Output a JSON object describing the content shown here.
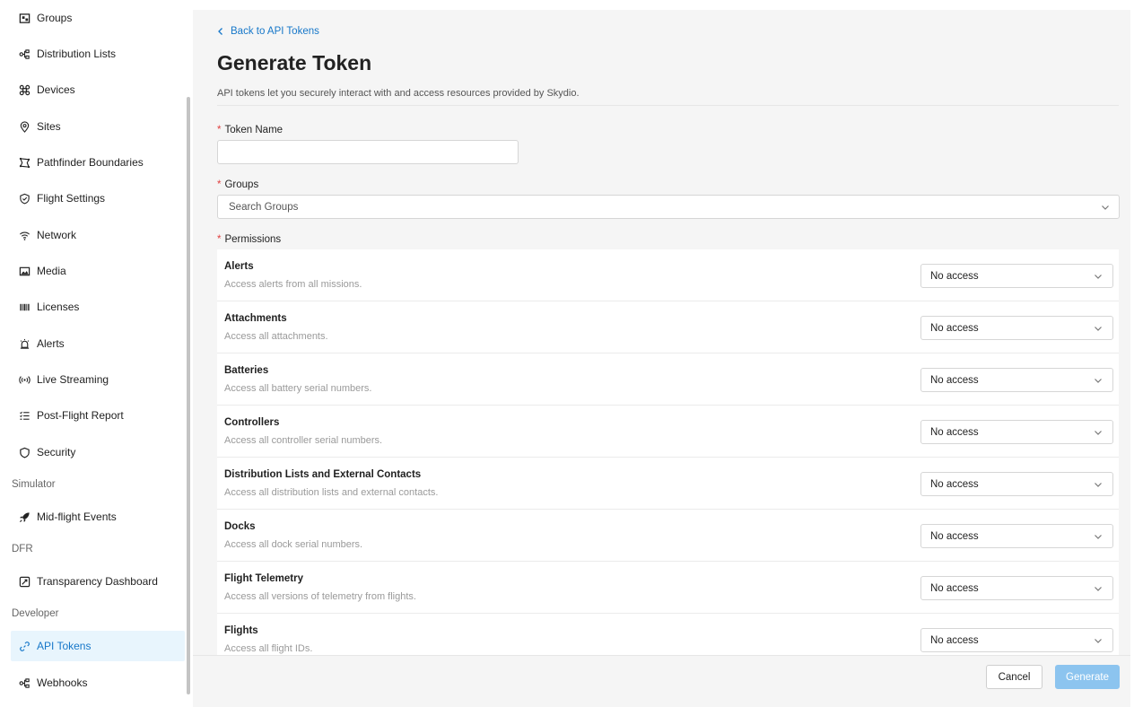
{
  "sidebar": {
    "items": [
      {
        "label": "Groups",
        "icon": "groups-icon"
      },
      {
        "label": "Distribution Lists",
        "icon": "distribution-icon"
      },
      {
        "label": "Devices",
        "icon": "devices-icon"
      },
      {
        "label": "Sites",
        "icon": "location-pin-icon"
      },
      {
        "label": "Pathfinder Boundaries",
        "icon": "boundaries-icon"
      },
      {
        "label": "Flight Settings",
        "icon": "shield-check-icon"
      },
      {
        "label": "Network",
        "icon": "wifi-icon"
      },
      {
        "label": "Media",
        "icon": "image-icon"
      },
      {
        "label": "Licenses",
        "icon": "barcode-icon"
      },
      {
        "label": "Alerts",
        "icon": "alarm-icon"
      },
      {
        "label": "Live Streaming",
        "icon": "broadcast-icon"
      },
      {
        "label": "Post-Flight Report",
        "icon": "list-check-icon"
      },
      {
        "label": "Security",
        "icon": "shield-icon"
      }
    ],
    "sections": {
      "simulator": "Simulator",
      "dfr": "DFR",
      "developer": "Developer"
    },
    "simulator_items": [
      {
        "label": "Mid-flight Events",
        "icon": "rocket-icon"
      }
    ],
    "dfr_items": [
      {
        "label": "Transparency Dashboard",
        "icon": "dashboard-icon"
      }
    ],
    "developer_items": [
      {
        "label": "API Tokens",
        "icon": "link-icon",
        "active": true
      },
      {
        "label": "Webhooks",
        "icon": "webhook-icon"
      }
    ]
  },
  "main": {
    "back_label": "Back to API Tokens",
    "title": "Generate Token",
    "description": "API tokens let you securely interact with and access resources provided by Skydio.",
    "token_name_label": "Token Name",
    "token_name_value": "",
    "groups_label": "Groups",
    "groups_placeholder": "Search Groups",
    "permissions_label": "Permissions",
    "required_mark": "*",
    "permissions": [
      {
        "title": "Alerts",
        "desc": "Access alerts from all missions.",
        "value": "No access"
      },
      {
        "title": "Attachments",
        "desc": "Access all attachments.",
        "value": "No access"
      },
      {
        "title": "Batteries",
        "desc": "Access all battery serial numbers.",
        "value": "No access"
      },
      {
        "title": "Controllers",
        "desc": "Access all controller serial numbers.",
        "value": "No access"
      },
      {
        "title": "Distribution Lists and External Contacts",
        "desc": "Access all distribution lists and external contacts.",
        "value": "No access"
      },
      {
        "title": "Docks",
        "desc": "Access all dock serial numbers.",
        "value": "No access"
      },
      {
        "title": "Flight Telemetry",
        "desc": "Access all versions of telemetry from flights.",
        "value": "No access"
      },
      {
        "title": "Flights",
        "desc": "Access all flight IDs.",
        "value": "No access"
      }
    ],
    "cancel_label": "Cancel",
    "generate_label": "Generate"
  },
  "colors": {
    "accent": "#1677c9",
    "active_bg": "#e8f5fd",
    "generate_bg": "#8cc4ef",
    "required": "#e04040"
  }
}
